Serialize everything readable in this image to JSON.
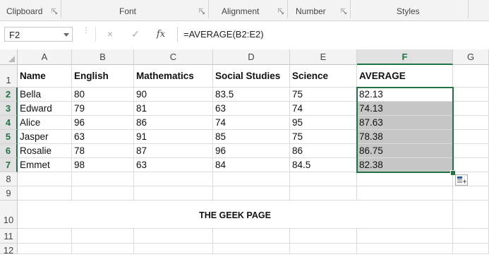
{
  "ribbon": {
    "groups": [
      "Clipboard",
      "Font",
      "Alignment",
      "Number",
      "Styles"
    ]
  },
  "formula_bar": {
    "name_box": "F2",
    "cancel_icon": "×",
    "enter_icon": "✓",
    "fx_label": "fx",
    "formula": "=AVERAGE(B2:E2)"
  },
  "sheet": {
    "columns": [
      "A",
      "B",
      "C",
      "D",
      "E",
      "F",
      "G"
    ],
    "selected_column": "F",
    "rows": [
      "1",
      "2",
      "3",
      "4",
      "5",
      "6",
      "7",
      "8",
      "9",
      "10",
      "11",
      "12"
    ],
    "header_row": [
      "Name",
      "English",
      "Mathematics",
      "Social Studies",
      "Science",
      "AVERAGE"
    ],
    "data_rows": [
      [
        "Bella",
        "80",
        "90",
        "83.5",
        "75",
        "82.13"
      ],
      [
        "Edward",
        "79",
        "81",
        "63",
        "74",
        "74.13"
      ],
      [
        "Alice",
        "96",
        "86",
        "74",
        "95",
        "87.63"
      ],
      [
        "Jasper",
        "63",
        "91",
        "85",
        "75",
        "78.38"
      ],
      [
        "Rosalie",
        "78",
        "87",
        "96",
        "86",
        "86.75"
      ],
      [
        "Emmet",
        "98",
        "63",
        "84",
        "84.5",
        "82.38"
      ]
    ],
    "watermark_text": "THE GEEK PAGE"
  }
}
